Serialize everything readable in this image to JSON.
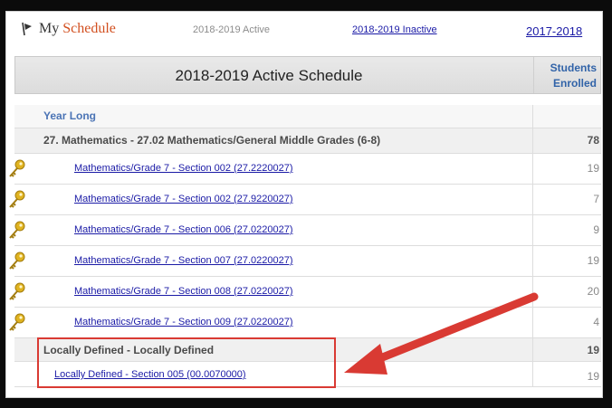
{
  "tabs": {
    "my_schedule_part1": "My ",
    "my_schedule_part2": "Schedule",
    "active": "2018-2019 Active",
    "inactive": "2018-2019 Inactive",
    "previous": "2017-2018"
  },
  "header": {
    "title": "2018-2019 Active Schedule",
    "students_line1": "Students",
    "students_line2": "Enrolled"
  },
  "rows": {
    "year_long": "Year Long",
    "math_group": {
      "label": "27. Mathematics - 27.02 Mathematics/General Middle Grades (6-8)",
      "count": "78"
    },
    "sections": [
      {
        "label": "Mathematics/Grade 7  - Section 002 (27.2220027)",
        "count": "19"
      },
      {
        "label": "Mathematics/Grade 7  - Section 002 (27.9220027)",
        "count": "7"
      },
      {
        "label": "Mathematics/Grade 7  - Section 006 (27.0220027)",
        "count": "9"
      },
      {
        "label": "Mathematics/Grade 7  - Section 007 (27.0220027)",
        "count": "19"
      },
      {
        "label": "Mathematics/Grade 7  - Section 008 (27.0220027)",
        "count": "20"
      },
      {
        "label": "Mathematics/Grade 7  - Section 009 (27.0220027)",
        "count": "4"
      }
    ],
    "local_group": {
      "label": "Locally Defined - Locally Defined",
      "count": "19"
    },
    "local_section": {
      "label": "Locally Defined - Section 005 (00.0070000)",
      "count": "19"
    }
  },
  "colors": {
    "highlight": "#d93a33",
    "link": "#1a1aa6",
    "key_icon": "#e0b320"
  }
}
